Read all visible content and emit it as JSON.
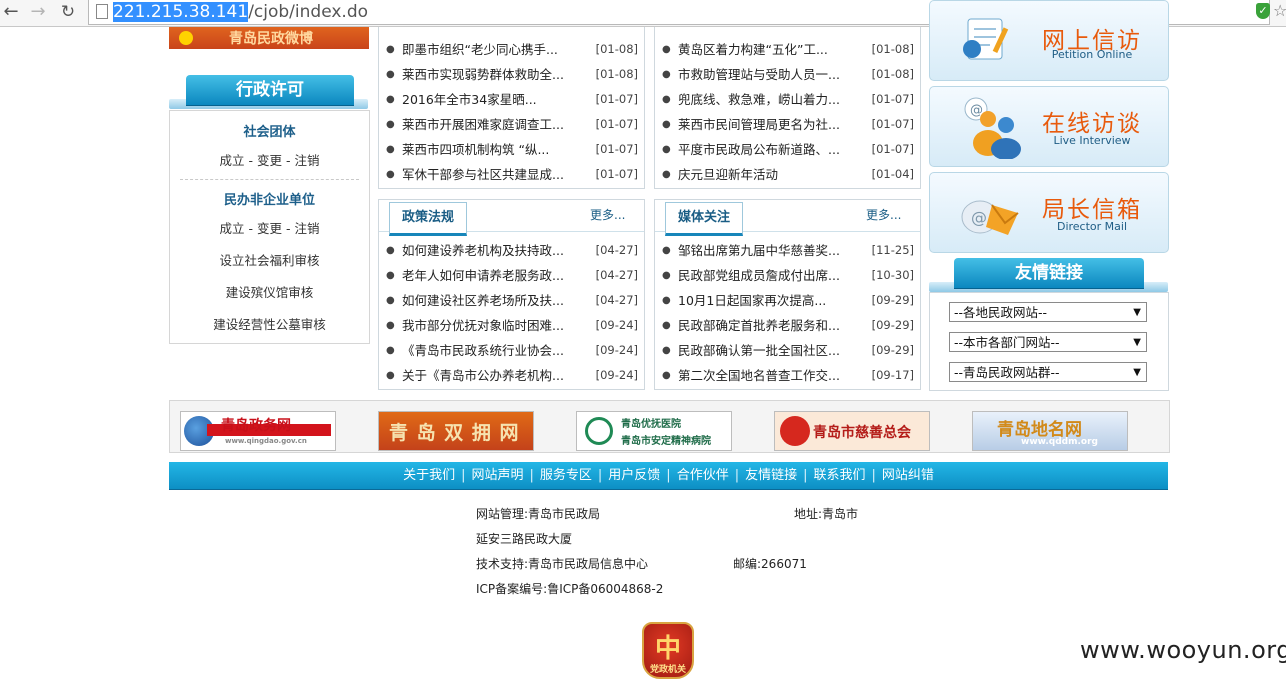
{
  "browser": {
    "url_highlight": "221.215.38.141",
    "url_rest": "/cjob/index.do"
  },
  "left": {
    "banner_text": "青岛民政微博",
    "section_title": "行政许可",
    "groups": [
      {
        "title": "社会团体",
        "actions": "成立 - 变更 - 注销"
      },
      {
        "title": "民办非企业单位",
        "actions": "成立 - 变更 - 注销"
      }
    ],
    "links": [
      "设立社会福利审核",
      "建设殡仪馆审核",
      "建设经营性公墓审核"
    ]
  },
  "news_top_left": [
    {
      "title": "即墨市组织“老少同心携手...",
      "date": "[01-08]"
    },
    {
      "title": "莱西市实现弱势群体救助全...",
      "date": "[01-08]"
    },
    {
      "title": "2016年全市34家星晒...",
      "date": "[01-07]"
    },
    {
      "title": "莱西市开展困难家庭调查工...",
      "date": "[01-07]"
    },
    {
      "title": "莱西市四项机制构筑 “纵...",
      "date": "[01-07]"
    },
    {
      "title": "军休干部参与社区共建显成...",
      "date": "[01-07]"
    }
  ],
  "news_top_right": [
    {
      "title": "黄岛区着力构建“五化”工...",
      "date": "[01-08]"
    },
    {
      "title": "市救助管理站与受助人员一...",
      "date": "[01-08]"
    },
    {
      "title": "兜底线、救急难，崂山着力...",
      "date": "[01-07]"
    },
    {
      "title": "莱西市民间管理局更名为社...",
      "date": "[01-07]"
    },
    {
      "title": "平度市民政局公布新道路、...",
      "date": "[01-07]"
    },
    {
      "title": "庆元旦迎新年活动",
      "date": "[01-04]"
    }
  ],
  "policy": {
    "tab": "政策法规",
    "more": "更多...",
    "items": [
      {
        "title": "如何建设养老机构及扶持政...",
        "date": "[04-27]"
      },
      {
        "title": "老年人如何申请养老服务政...",
        "date": "[04-27]"
      },
      {
        "title": "如何建设社区养老场所及扶...",
        "date": "[04-27]"
      },
      {
        "title": "我市部分优抚对象临时困难...",
        "date": "[09-24]"
      },
      {
        "title": "《青岛市民政系统行业协会...",
        "date": "[09-24]"
      },
      {
        "title": "关于《青岛市公办养老机构...",
        "date": "[09-24]"
      }
    ]
  },
  "media": {
    "tab": "媒体关注",
    "more": "更多...",
    "items": [
      {
        "title": "邹铭出席第九届中华慈善奖...",
        "date": "[11-25]"
      },
      {
        "title": "民政部党组成员詹成付出席...",
        "date": "[10-30]"
      },
      {
        "title": "10月1日起国家再次提高...",
        "date": "[09-29]"
      },
      {
        "title": "民政部确定首批养老服务和...",
        "date": "[09-29]"
      },
      {
        "title": "民政部确认第一批全国社区...",
        "date": "[09-29]"
      },
      {
        "title": "第二次全国地名普查工作交...",
        "date": "[09-17]"
      }
    ]
  },
  "services": [
    {
      "zh": "网上信访",
      "en": "Petition Online"
    },
    {
      "zh": "在线访谈",
      "en": "Live Interview"
    },
    {
      "zh": "局长信箱",
      "en": "Director Mail"
    }
  ],
  "friend_links": {
    "title": "友情链接",
    "selects": [
      "--各地民政网站--",
      "--本市各部门网站--",
      "--青岛民政网站群--"
    ]
  },
  "logos": [
    {
      "name": "青岛政务网",
      "sub": "www.qingdao.gov.cn"
    },
    {
      "name": "青 岛 双 拥 网",
      "sub": ""
    },
    {
      "name": "青岛优抚医院",
      "sub": "青岛市安定精神病院"
    },
    {
      "name": "青岛市慈善总会",
      "sub": ""
    },
    {
      "name": "青岛地名网",
      "sub": "www.qddm.org"
    }
  ],
  "footer": {
    "links": [
      "关于我们",
      "网站声明",
      "服务专区",
      "用户反馈",
      "合作伙伴",
      "友情链接",
      "联系我们",
      "网站纠错"
    ],
    "admin": "网站管理:青岛市民政局",
    "address_label": "地址:青岛市",
    "address_cont": "延安三路民政大厦",
    "tech": "技术支持:青岛市民政局信息中心",
    "postcode": "邮编:266071",
    "icp": "ICP备案编号:鲁ICP备06004868-2",
    "badge_text": "党政机关"
  },
  "watermark": "www.wooyun.org"
}
